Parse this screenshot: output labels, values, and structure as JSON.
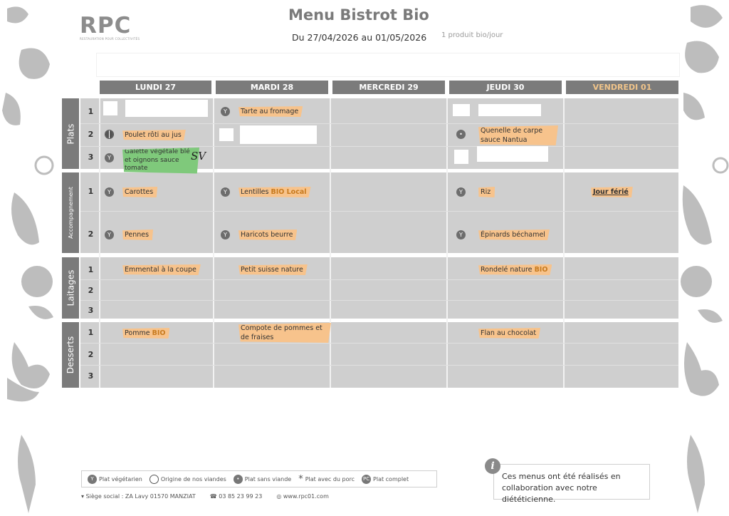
{
  "header": {
    "logo": "RPC",
    "logo_sub": "RESTAURATION POUR COLLECTIVITÉS",
    "title": "Menu Bistrot Bio",
    "dates": "Du 27/04/2026 au 01/05/2026",
    "note": "1 produit bio/jour"
  },
  "days": [
    "LUNDI 27",
    "MARDI 28",
    "MERCREDI 29",
    "JEUDI 30",
    "VENDREDI 01"
  ],
  "sections": {
    "plats": "Plats",
    "accompagnement": "Accompagnement",
    "laitages": "Laitages",
    "desserts": "Desserts"
  },
  "rows": {
    "n1": "1",
    "n2": "2",
    "n3": "3"
  },
  "items": {
    "lun_plat2": "Poulet rôti au jus",
    "lun_plat3": "Galette végétale blé et oignons sauce tomate",
    "lun_acc1": "Carottes",
    "lun_acc2": "Pennes",
    "lun_lait1": "Emmental à la coupe",
    "lun_des1": "Pomme",
    "mar_plat1": "Tarte au fromage",
    "mar_acc1": "Lentilles",
    "mar_acc2": "Haricots beurre",
    "mar_lait1": "Petit suisse nature",
    "mar_des1": "Compote de pommes et de fraises",
    "jeu_plat2": "Quenelle de carpe sauce Nantua",
    "jeu_acc1": "Riz",
    "jeu_acc2": "Épinards béchamel",
    "jeu_lait1": "Rondelé nature",
    "jeu_des1": "Flan au chocolat",
    "ven_acc1": "Jour férié"
  },
  "bio_tags": {
    "bio": "BIO",
    "bio_local": "BIO Local"
  },
  "handwritten": "SV",
  "legend": {
    "veg": "Plat végétarien",
    "origin": "Origine de nos viandes",
    "nomeat": "Plat sans viande",
    "pork": "Plat avec du porc",
    "complete": "Plat complet",
    "star": "*",
    "pc": "PC"
  },
  "footer": {
    "address": "Siège social : ZA Lavy 01570 MANZIAT",
    "phone": "03 85 23 99 23",
    "web": "www.rpc01.com"
  },
  "info": {
    "icon": "i",
    "text": "Ces menus ont été réalisés en collaboration avec notre diététicienne."
  },
  "colors": {
    "header_gray": "#7b7b7b",
    "cell_gray": "#cfcfcf",
    "highlight": "#f7c38c",
    "green": "#7fc97b",
    "bio": "#c77a1e"
  },
  "icons": {
    "veg": "vegetarian-icon",
    "meat": "meat-origin-icon",
    "fish": "no-meat-icon"
  }
}
